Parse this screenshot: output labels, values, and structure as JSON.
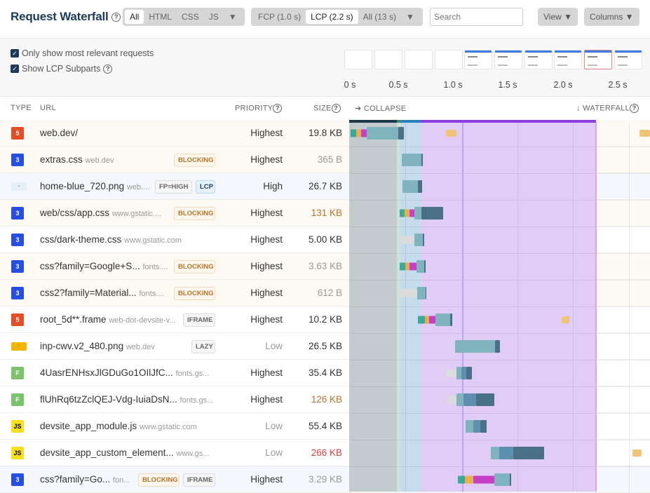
{
  "header": {
    "title": "Request Waterfall",
    "type_filters": [
      "All",
      "HTML",
      "CSS",
      "JS"
    ],
    "type_active": 0,
    "range_filters": [
      "FCP (1.0 s)",
      "LCP (2.2 s)",
      "All (13 s)"
    ],
    "range_active": 1,
    "search_placeholder": "Search",
    "view_label": "View ▼",
    "columns_label": "Columns ▼",
    "dropdown": "▼"
  },
  "options": {
    "only_relevant": "Only show most relevant requests",
    "show_lcp": "Show LCP Subparts",
    "only_relevant_checked": true,
    "show_lcp_checked": true
  },
  "filmstrip": {
    "ticks": [
      "0 s",
      "0.5 s",
      "1.0 s",
      "1.5 s",
      "2.0 s",
      "2.5 s"
    ]
  },
  "columns": {
    "type": "TYPE",
    "url": "URL",
    "priority": "PRIORITY",
    "size": "SIZE",
    "collapse": "➔ COLLAPSE",
    "waterfall": "↓ WATERFALL"
  },
  "colors": {
    "html": "#e44d26",
    "css": "#264de4",
    "js": "#f7df1e",
    "font": "#7cc36e",
    "lcp_phase": "#8a3ee0",
    "render_delay": "#e0ccf5"
  },
  "rows": [
    {
      "type": "html",
      "url": "web.dev/",
      "host": "",
      "badges": [],
      "priority": "Highest",
      "size": "19.8 KB",
      "size_color": "#333"
    },
    {
      "type": "css",
      "url": "extras.css",
      "host": "web.dev",
      "badges": [
        "BLOCKING"
      ],
      "priority": "Highest",
      "size": "365 B",
      "size_color": "#999"
    },
    {
      "type": "img",
      "url": "home-blue_720.png",
      "host": "web....",
      "badges": [
        "FP=HIGH",
        "LCP"
      ],
      "priority": "High",
      "size": "26.7 KB",
      "size_color": "#333"
    },
    {
      "type": "css",
      "url": "web/css/app.css",
      "host": "www.gstatic....",
      "badges": [
        "BLOCKING"
      ],
      "priority": "Highest",
      "size": "131 KB",
      "size_color": "#b8742a"
    },
    {
      "type": "css",
      "url": "css/dark-theme.css",
      "host": "www.gstatic.com",
      "badges": [],
      "priority": "Highest",
      "size": "5.00 KB",
      "size_color": "#333"
    },
    {
      "type": "css",
      "url": "css?family=Google+S...",
      "host": "fonts....",
      "badges": [
        "BLOCKING"
      ],
      "priority": "Highest",
      "size": "3.63 KB",
      "size_color": "#999"
    },
    {
      "type": "css",
      "url": "css2?family=Material...",
      "host": "fonts....",
      "badges": [
        "BLOCKING"
      ],
      "priority": "Highest",
      "size": "612 B",
      "size_color": "#999"
    },
    {
      "type": "html",
      "url": "root_5d**.frame",
      "host": "web-dot-devsite-v...",
      "badges": [
        "IFRAME"
      ],
      "priority": "Highest",
      "size": "10.2 KB",
      "size_color": "#333"
    },
    {
      "type": "img2",
      "url": "inp-cwv.v2_480.png",
      "host": "web.dev",
      "badges": [
        "LAZY"
      ],
      "priority": "Low",
      "size": "26.5 KB",
      "size_color": "#333"
    },
    {
      "type": "font",
      "url": "4UasrENHsxJlGDuGo1OIlJfC...",
      "host": "fonts.gs...",
      "badges": [],
      "priority": "Highest",
      "size": "35.4 KB",
      "size_color": "#333"
    },
    {
      "type": "font",
      "url": "flUhRq6tzZclQEJ-Vdg-IuiaDsN...",
      "host": "fonts.gs...",
      "badges": [],
      "priority": "Highest",
      "size": "126 KB",
      "size_color": "#b8742a"
    },
    {
      "type": "js",
      "url": "devsite_app_module.js",
      "host": "www.gstatic.com",
      "badges": [],
      "priority": "Low",
      "size": "55.4 KB",
      "size_color": "#333"
    },
    {
      "type": "js",
      "url": "devsite_app_custom_element...",
      "host": "www.gs...",
      "badges": [],
      "priority": "Low",
      "size": "266 KB",
      "size_color": "#e03c3c"
    },
    {
      "type": "css",
      "url": "css?family=Go...",
      "host": "fon...",
      "badges": [
        "BLOCKING",
        "IFRAME"
      ],
      "priority": "Highest",
      "size": "3.29 KB",
      "size_color": "#999"
    }
  ]
}
